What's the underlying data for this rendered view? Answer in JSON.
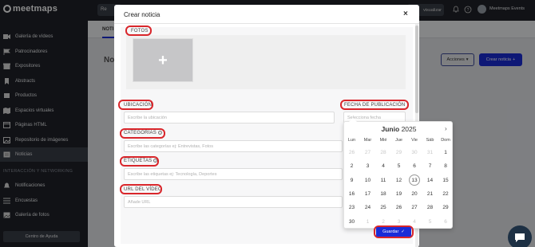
{
  "app": {
    "logo_text": "meetmaps"
  },
  "sidebar": {
    "items": [
      {
        "label": "Galería de vídeos",
        "icon": "video-icon"
      },
      {
        "label": "Patrocinadores",
        "icon": "flag-icon"
      },
      {
        "label": "Expositores",
        "icon": "store-icon"
      },
      {
        "label": "Abstracts",
        "icon": "bookmark-icon"
      },
      {
        "label": "Productos",
        "icon": "product-icon"
      },
      {
        "label": "Espacios virtuales",
        "icon": "map-icon"
      },
      {
        "label": "Páginas HTML",
        "icon": "html-icon"
      },
      {
        "label": "Repositorio de imágenes",
        "icon": "image-icon"
      },
      {
        "label": "Noticias",
        "icon": "news-icon",
        "active": true
      }
    ],
    "section_label": "INTERACCIÓN Y NETWORKING",
    "items2": [
      {
        "label": "Notificaciones",
        "icon": "bell-icon"
      },
      {
        "label": "Encuestas",
        "icon": "list-icon"
      },
      {
        "label": "Galería de fotos",
        "icon": "gallery-icon"
      }
    ],
    "help_label": "Centro de Ayuda"
  },
  "topbar": {
    "left_button": "Re",
    "right_button": "visualizar",
    "user_name": "Meetmaps Events"
  },
  "main": {
    "tab": "NOTI",
    "title": "Not",
    "actions_label": "Acciones",
    "create_label": "Crear noticia"
  },
  "modal": {
    "title": "Crear noticia",
    "close": "×",
    "photos_label": "FOTOS",
    "location_label": "UBICACIÓN",
    "location_placeholder": "Escribe la ubicación",
    "date_label": "FECHA DE PUBLICACIÓN",
    "date_placeholder": "Selecciona fecha",
    "categories_label": "CATEGORÍAS",
    "categories_placeholder": "Escribe las categorías ej: Entrevistas, Fotos",
    "tags_label": "ETIQUETAS",
    "tags_placeholder": "Escribe las etiquetas ej: Tecnología, Deportes",
    "url_label": "URL DEL VÍDEO",
    "url_placeholder": "Añade URL",
    "save_label": "Guardar"
  },
  "calendar": {
    "month": "Junio",
    "year": "2025",
    "weekdays": [
      "Lun",
      "Mar",
      "Mié",
      "Jue",
      "Vie",
      "Sáb",
      "Dom"
    ],
    "weeks": [
      [
        "26",
        "27",
        "28",
        "29",
        "30",
        "31",
        "1"
      ],
      [
        "2",
        "3",
        "4",
        "5",
        "6",
        "7",
        "8"
      ],
      [
        "9",
        "10",
        "11",
        "12",
        "13",
        "14",
        "15"
      ],
      [
        "16",
        "17",
        "18",
        "19",
        "20",
        "21",
        "22"
      ],
      [
        "23",
        "24",
        "25",
        "26",
        "27",
        "28",
        "29"
      ],
      [
        "30",
        "1",
        "2",
        "3",
        "4",
        "5",
        "6"
      ]
    ],
    "today": "13"
  },
  "colors": {
    "accent": "#1a2cd8",
    "highlight": "#d9262b",
    "sidebar": "#1f2229"
  }
}
